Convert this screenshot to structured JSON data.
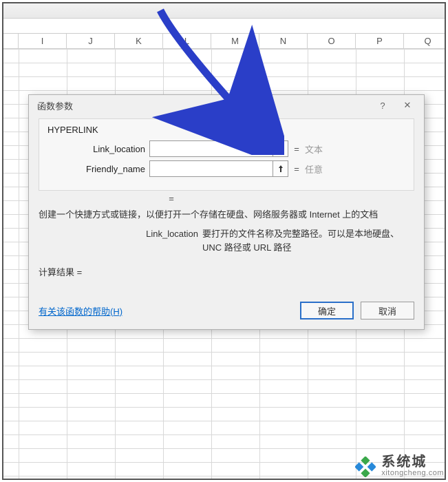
{
  "columns": [
    "I",
    "J",
    "K",
    "L",
    "M",
    "N",
    "O",
    "P",
    "Q"
  ],
  "dialog": {
    "title": "函数参数",
    "function_name": "HYPERLINK",
    "args": [
      {
        "label": "Link_location",
        "value": "",
        "hint": "文本"
      },
      {
        "label": "Friendly_name",
        "value": "",
        "hint": "任意"
      }
    ],
    "equals": "=",
    "description": "创建一个快捷方式或链接，以便打开一个存储在硬盘、网络服务器或 Internet 上的文档",
    "arg_detail_key": "Link_location",
    "arg_detail_val": "要打开的文件名称及完整路径。可以是本地硬盘、UNC 路径或 URL 路径",
    "result_label": "计算结果 =",
    "help_text": "有关该函数的帮助(H)",
    "ok": "确定",
    "cancel": "取消",
    "help_symbol": "?",
    "close_symbol": "✕"
  },
  "watermark": {
    "cn": "系统城",
    "en": "xitongcheng.com"
  }
}
